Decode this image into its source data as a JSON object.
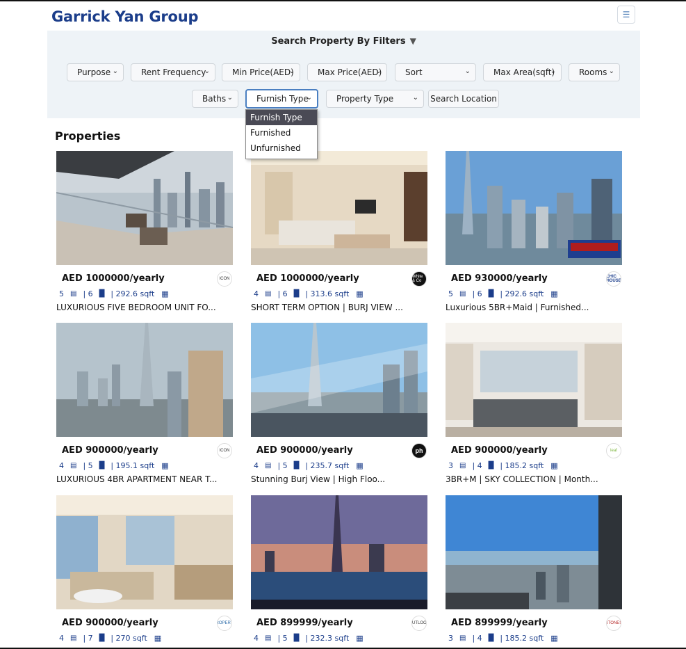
{
  "header": {
    "brand": "Garrick Yan Group",
    "menu_icon": "hamburger-icon"
  },
  "filters": {
    "title": "Search Property By Filters",
    "row1": [
      "Purpose",
      "Rent Frequency",
      "Min Price(AED)",
      "Max Price(AED)",
      "Sort",
      "Max Area(sqft)",
      "Rooms"
    ],
    "row2": {
      "baths": "Baths",
      "furnish": "Furnish Type",
      "property_type": "Property Type",
      "search_location": "Search Location"
    },
    "furnish_options": [
      "Furnish Type",
      "Furnished",
      "Unfurnished"
    ]
  },
  "section_title": "Properties",
  "properties": [
    {
      "price": "AED 1000000/yearly",
      "rooms": "5",
      "baths": "| 6",
      "area": "| 292.6 sqft",
      "title": "LUXURIOUS FIVE BEDROOM UNIT FO...",
      "agency": "ICON"
    },
    {
      "price": "AED 1000000/yearly",
      "rooms": "4",
      "baths": "| 6",
      "area": "| 313.6 sqft",
      "title": "SHORT TERM OPTION | BURJ VIEW ...",
      "agency": "White & Co"
    },
    {
      "price": "AED 930000/yearly",
      "rooms": "5",
      "baths": "| 6",
      "area": "| 292.6 sqft",
      "title": "Luxurious 5BR+Maid | Furnished...",
      "agency": "CHIC HOUSE"
    },
    {
      "price": "AED 900000/yearly",
      "rooms": "4",
      "baths": "| 5",
      "area": "| 195.1 sqft",
      "title": "LUXURIOUS 4BR APARTMENT NEAR T...",
      "agency": "ICON"
    },
    {
      "price": "AED 900000/yearly",
      "rooms": "4",
      "baths": "| 5",
      "area": "| 235.7 sqft",
      "title": "Stunning Burj View | High Floo...",
      "agency": "ph"
    },
    {
      "price": "AED 900000/yearly",
      "rooms": "3",
      "baths": "| 4",
      "area": "| 185.2 sqft",
      "title": "3BR+M | SKY COLLECTION | Month...",
      "agency": "leaf"
    },
    {
      "price": "AED 900000/yearly",
      "rooms": "4",
      "baths": "| 7",
      "area": "| 270 sqft",
      "title": "",
      "agency": "PROPERTY"
    },
    {
      "price": "AED 899999/yearly",
      "rooms": "4",
      "baths": "| 5",
      "area": "| 232.3 sqft",
      "title": "",
      "agency": "OUTLOOK"
    },
    {
      "price": "AED 899999/yearly",
      "rooms": "3",
      "baths": "| 4",
      "area": "| 185.2 sqft",
      "title": "",
      "agency": "STONES"
    }
  ],
  "colors": {
    "brand": "#1b3d8a",
    "panel": "#eef3f7",
    "accent": "#4a7fc1"
  }
}
